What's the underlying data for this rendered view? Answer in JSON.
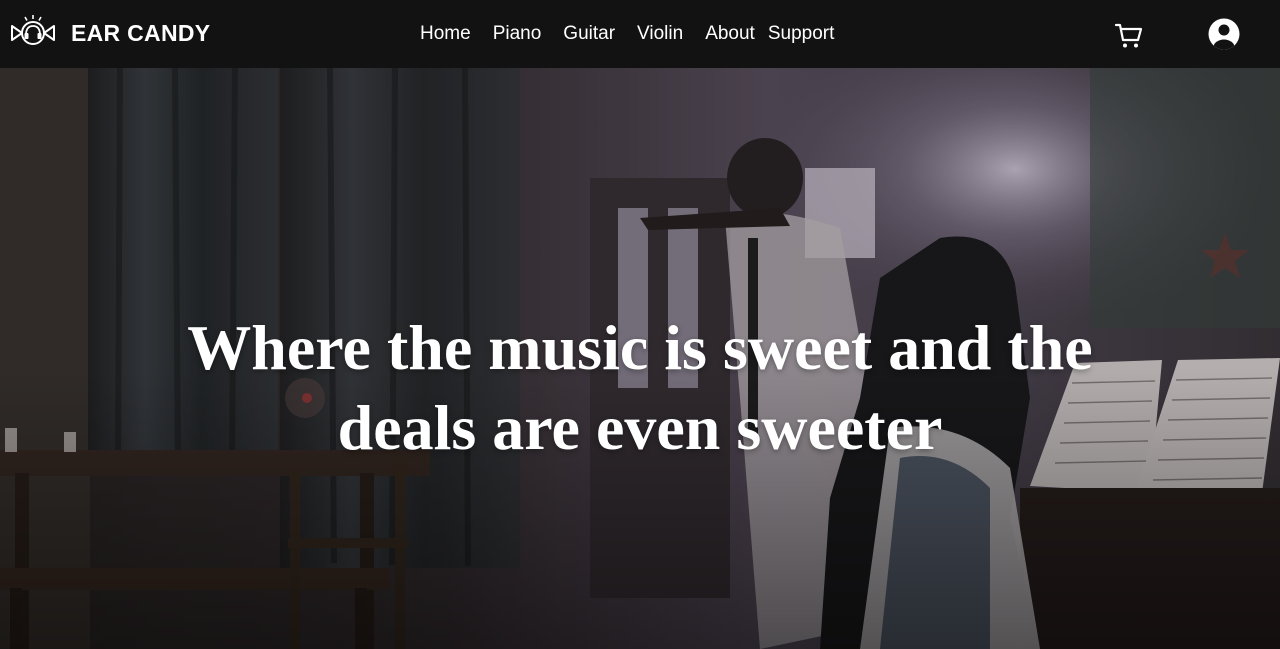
{
  "brand": {
    "name": "EAR CANDY",
    "logo_icon": "candy-headphones-icon"
  },
  "nav": {
    "items": [
      {
        "label": "Home"
      },
      {
        "label": "Piano"
      },
      {
        "label": "Guitar"
      },
      {
        "label": "Violin"
      },
      {
        "label": "About"
      },
      {
        "label": "Support"
      }
    ]
  },
  "actions": {
    "cart_icon": "cart-icon",
    "account_icon": "user-circle-icon"
  },
  "hero": {
    "title": "Where the music is sweet and the deals are even sweeter"
  },
  "colors": {
    "navbar_bg": "#121212",
    "text": "#ffffff"
  }
}
